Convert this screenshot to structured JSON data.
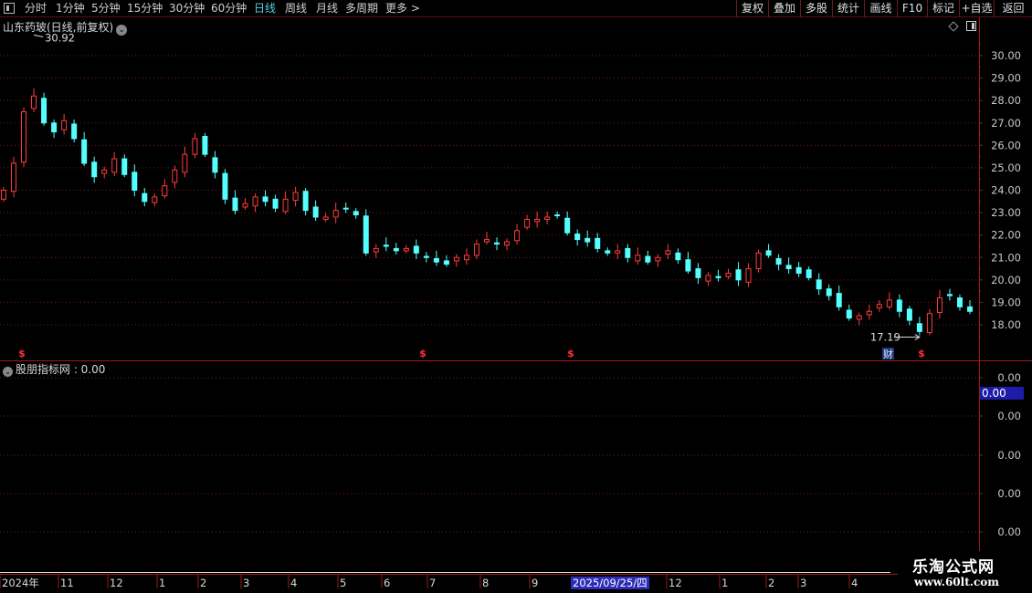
{
  "toolbar": {
    "tabs": [
      {
        "label": "分时",
        "active": false
      },
      {
        "label": "1分钟",
        "active": false
      },
      {
        "label": "5分钟",
        "active": false
      },
      {
        "label": "15分钟",
        "active": false
      },
      {
        "label": "30分钟",
        "active": false
      },
      {
        "label": "60分钟",
        "active": false
      },
      {
        "label": "日线",
        "active": true
      },
      {
        "label": "周线",
        "active": false
      },
      {
        "label": "月线",
        "active": false
      },
      {
        "label": "多周期",
        "active": false
      },
      {
        "label": "更多 >",
        "active": false
      }
    ],
    "right_buttons": [
      "复权",
      "叠加",
      "多股",
      "统计",
      "画线",
      "F10",
      "标记",
      "+自选",
      "返回"
    ]
  },
  "main_chart": {
    "title": "山东药玻(日线,前复权)",
    "price_axis": [
      "30.00",
      "29.00",
      "28.00",
      "27.00",
      "26.00",
      "25.00",
      "24.00",
      "23.00",
      "22.00",
      "21.00",
      "20.00",
      "19.00",
      "18.00"
    ],
    "high_label": "30.92",
    "low_label": "17.19",
    "finance_marker": "财",
    "event_marker": "$"
  },
  "indicator": {
    "title": "股朋指标网 : 0.00",
    "axis_labels": [
      "0.00",
      "0.00",
      "0.00",
      "0.00",
      "0.00"
    ],
    "current_value": "0.00"
  },
  "time_axis": {
    "labels": [
      "2024年",
      "11",
      "12",
      "1",
      "2",
      "3",
      "4",
      "5",
      "6",
      "7",
      "8",
      "9",
      "12",
      "1",
      "2",
      "3",
      "4"
    ],
    "highlight_date": "2025/09/25/四"
  },
  "watermark": {
    "title": "乐淘公式网",
    "url": "www.60lt.com"
  },
  "colors": {
    "up": "#ff3c3c",
    "down": "#54ffff",
    "grid": "#7a1a1a",
    "axis": "#a01818",
    "text": "#c8c8c8"
  },
  "chart_data": {
    "type": "candlestick",
    "ylim": [
      17.2,
      30.92
    ],
    "x_tick_labels": [
      "2024年",
      "11",
      "12",
      "1",
      "2",
      "3",
      "4",
      "5",
      "6",
      "7",
      "8",
      "9",
      "12",
      "1",
      "2",
      "3",
      "4"
    ],
    "close_series": [
      24.0,
      25.2,
      27.5,
      28.2,
      27.0,
      26.6,
      27.1,
      26.3,
      25.2,
      24.6,
      24.9,
      25.4,
      24.7,
      24.0,
      23.5,
      23.7,
      24.2,
      24.9,
      25.6,
      26.3,
      25.6,
      24.8,
      23.6,
      23.1,
      23.4,
      23.7,
      23.5,
      23.2,
      23.6,
      23.9,
      23.1,
      22.8,
      22.8,
      23.1,
      23.2,
      22.9,
      21.2,
      21.4,
      21.5,
      21.3,
      21.4,
      21.2,
      21.0,
      20.8,
      20.7,
      21.0,
      21.1,
      21.6,
      21.8,
      21.6,
      21.7,
      22.2,
      22.7,
      22.7,
      22.8,
      22.9,
      22.1,
      21.8,
      21.7,
      21.4,
      21.2,
      21.3,
      21.0,
      21.1,
      20.8,
      21.0,
      21.3,
      20.9,
      20.4,
      20.1,
      20.2,
      20.1,
      20.3,
      20.0,
      20.5,
      21.2,
      21.1,
      20.7,
      20.5,
      20.3,
      20.1,
      19.6,
      19.3,
      18.8,
      18.3,
      18.4,
      18.6,
      18.9,
      19.1,
      18.6,
      18.2,
      17.7,
      18.5,
      19.2,
      19.3,
      18.8,
      18.6
    ]
  }
}
